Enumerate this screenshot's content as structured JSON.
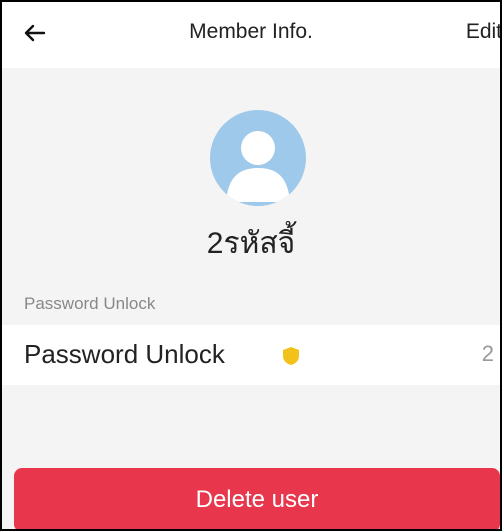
{
  "header": {
    "back_icon": "arrow-left-icon",
    "title": "Member Info.",
    "edit_label": "Edit"
  },
  "profile": {
    "avatar_icon": "user-avatar-icon",
    "name": "2รหัสจี้"
  },
  "password_section": {
    "label": "Password Unlock",
    "row_label": "Password Unlock",
    "shield_icon": "shield-icon",
    "count": "2"
  },
  "actions": {
    "delete_label": "Delete user"
  },
  "colors": {
    "delete_button": "#e8364c",
    "avatar_bg": "#9ec9ea",
    "shield": "#f2c21b"
  }
}
